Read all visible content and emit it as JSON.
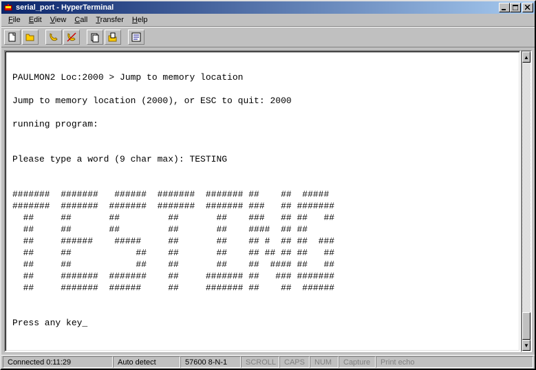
{
  "window": {
    "title": "serial_port - HyperTerminal"
  },
  "menubar": {
    "items": [
      {
        "label": "File",
        "accel": "F"
      },
      {
        "label": "Edit",
        "accel": "E"
      },
      {
        "label": "View",
        "accel": "V"
      },
      {
        "label": "Call",
        "accel": "C"
      },
      {
        "label": "Transfer",
        "accel": "T"
      },
      {
        "label": "Help",
        "accel": "H"
      }
    ]
  },
  "toolbar": {
    "buttons": [
      "new-file",
      "open-file",
      "",
      "connect",
      "disconnect",
      "",
      "send",
      "receive",
      "",
      "properties"
    ]
  },
  "terminal": {
    "lines": [
      "",
      "PAULMON2 Loc:2000 > Jump to memory location",
      "",
      "Jump to memory location (2000), or ESC to quit: 2000",
      "",
      "running program:",
      "",
      "",
      "Please type a word (9 char max): TESTING",
      "",
      "",
      "#######  #######   ######  #######  ####### ##    ##  #####",
      "#######  #######  #######  #######  ####### ###   ## #######",
      "  ##     ##       ##         ##       ##    ###   ## ##   ##",
      "  ##     ##       ##         ##       ##    ####  ## ##",
      "  ##     ######    #####     ##       ##    ## #  ## ##  ###",
      "  ##     ##            ##    ##       ##    ## ## ## ##   ##",
      "  ##     ##            ##    ##       ##    ##  #### ##   ##",
      "  ##     #######  #######    ##     ####### ##   ### #######",
      "  ##     #######  ######     ##     ####### ##    ##  ######",
      "",
      "",
      "Press any key_"
    ]
  },
  "statusbar": {
    "connected": "Connected 0:11:29",
    "autodetect": "Auto detect",
    "settings": "57600 8-N-1",
    "scroll": "SCROLL",
    "caps": "CAPS",
    "num": "NUM",
    "capture": "Capture",
    "printecho": "Print echo"
  }
}
